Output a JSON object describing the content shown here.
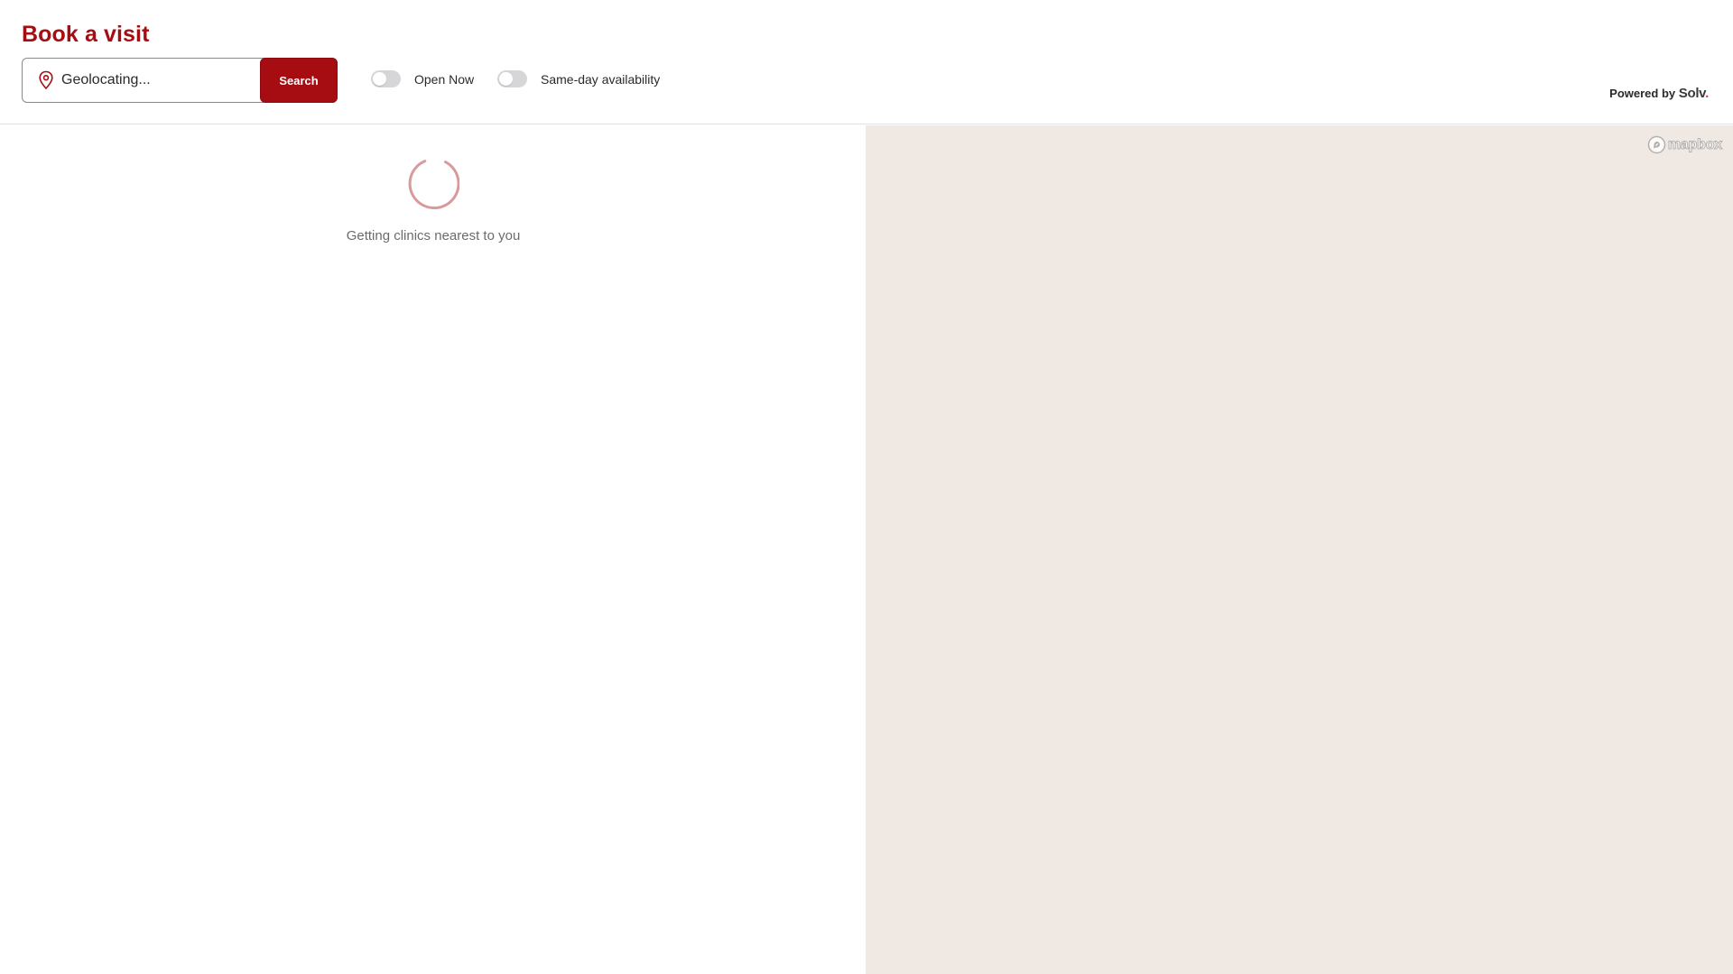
{
  "header": {
    "title": "Book a visit",
    "search": {
      "placeholder": "Geolocating...",
      "value": "",
      "button_label": "Search"
    },
    "filters": [
      {
        "label": "Open Now",
        "enabled": false
      },
      {
        "label": "Same-day availability",
        "enabled": false
      }
    ],
    "powered_by": {
      "prefix": "Powered by",
      "brand": "Solv",
      "brand_suffix": "."
    }
  },
  "results": {
    "loading_message": "Getting clinics nearest to you"
  },
  "map": {
    "attribution_logo": "mapbox"
  },
  "colors": {
    "brand_red": "#a50d12",
    "map_background": "#f0e9e3",
    "toggle_off": "#d6d6d9",
    "spinner": "#d99a9c"
  },
  "icons": {
    "search_field": "map-pin-icon",
    "loading": "spinner-icon",
    "map_attribution": "mapbox-icon"
  }
}
